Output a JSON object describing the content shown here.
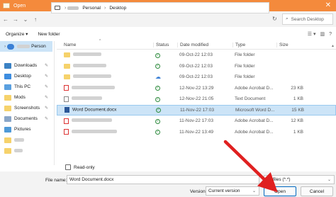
{
  "window": {
    "title": "Open",
    "close_glyph": "✕"
  },
  "address": {
    "breadcrumb": [
      "Personal",
      "Desktop"
    ],
    "search_placeholder": "Search Desktop"
  },
  "toolbar": {
    "organize": "Organize ▾",
    "new_folder": "New folder"
  },
  "sidebar": {
    "items": [
      {
        "label": "Person",
        "icon": "cloud-icon"
      },
      {
        "label": "Downloads",
        "icon": "download-icon"
      },
      {
        "label": "Desktop",
        "icon": "desktop-icon"
      },
      {
        "label": "This PC",
        "icon": "computer-icon"
      },
      {
        "label": "Mods",
        "icon": "folder-icon"
      },
      {
        "label": "Screenshots",
        "icon": "folder-icon"
      },
      {
        "label": "Documents",
        "icon": "document-icon"
      },
      {
        "label": "Pictures",
        "icon": "pictures-icon"
      }
    ]
  },
  "columns": {
    "name": "Name",
    "status": "Status",
    "date": "Date modified",
    "type": "Type",
    "size": "Size"
  },
  "files": [
    {
      "name": "",
      "status": "check",
      "date": "09-Oct-22 12:03",
      "type": "File folder",
      "size": "",
      "icon": "folder-icon"
    },
    {
      "name": "",
      "status": "check",
      "date": "09-Oct-22 12:03",
      "type": "File folder",
      "size": "",
      "icon": "folder-icon"
    },
    {
      "name": "",
      "status": "cloud",
      "date": "09-Oct-22 12:03",
      "type": "File folder",
      "size": "",
      "icon": "folder-icon"
    },
    {
      "name": "",
      "status": "check",
      "date": "12-Nov-22 13:29",
      "type": "Adobe Acrobat D...",
      "size": "23 KB",
      "icon": "pdf-icon"
    },
    {
      "name": "",
      "status": "check",
      "date": "12-Nov-22 21:05",
      "type": "Text Document",
      "size": "1 KB",
      "icon": "text-file-icon"
    },
    {
      "name": "Word Document.docx",
      "status": "check",
      "date": "11-Nov-22 17:03",
      "type": "Microsoft Word D...",
      "size": "15 KB",
      "icon": "word-file-icon",
      "selected": true
    },
    {
      "name": "",
      "status": "check",
      "date": "11-Nov-22 17:03",
      "type": "Adobe Acrobat D...",
      "size": "12 KB",
      "icon": "pdf-icon"
    },
    {
      "name": "",
      "status": "check",
      "date": "11-Nov-22 13:49",
      "type": "Adobe Acrobat D...",
      "size": "1 KB",
      "icon": "pdf-icon"
    }
  ],
  "read_only": "Read-only",
  "file_name_label": "File name:",
  "file_name_value": "Word Document.docx",
  "filter": "All files (*.*)",
  "version_label": "Version:",
  "version_value": "Current version",
  "buttons": {
    "open": "Open",
    "cancel": "Cancel"
  },
  "colors": {
    "titlebar": "#f48a3c",
    "selection": "#cce4f7",
    "arrow": "#e02020"
  }
}
